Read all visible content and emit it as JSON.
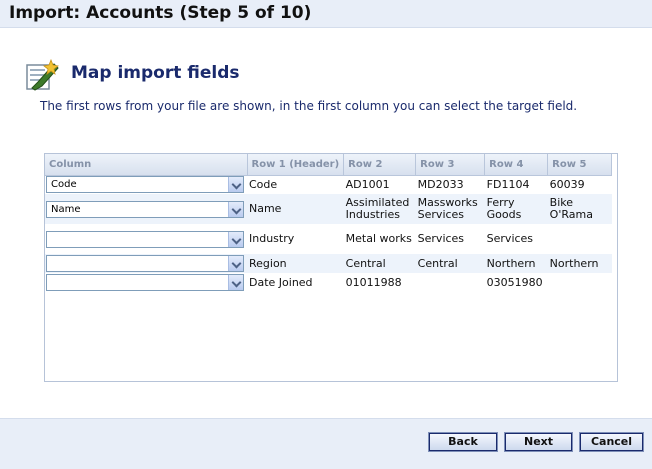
{
  "window": {
    "title": "Import: Accounts (Step 5 of 10)"
  },
  "section": {
    "icon": "wizard-wand-icon",
    "title": "Map import fields",
    "instructions": "The first rows from your file are shown, in the first column you can select the target field."
  },
  "grid": {
    "headers": [
      "Column",
      "Row 1 (Header)",
      "Row 2",
      "Row 3",
      "Row 4",
      "Row 5"
    ],
    "rows": [
      {
        "mapping": "Code",
        "cells": [
          "Code",
          "AD1001",
          "MD2033",
          "FD1104",
          "60039"
        ]
      },
      {
        "mapping": "Name",
        "cells": [
          "Name",
          "Assimilated Industries",
          "Massworks Services",
          "Ferry Goods",
          "Bike O'Rama"
        ]
      },
      {
        "mapping": "",
        "cells": [
          "Industry",
          "Metal works",
          "Services",
          "Services",
          ""
        ]
      },
      {
        "mapping": "",
        "cells": [
          "Region",
          "Central",
          "Central",
          "Northern",
          "Northern"
        ]
      },
      {
        "mapping": "",
        "cells": [
          "Date Joined",
          "01011988",
          "",
          "03051980",
          ""
        ]
      }
    ]
  },
  "buttons": {
    "back": "Back",
    "next": "Next",
    "cancel": "Cancel"
  }
}
